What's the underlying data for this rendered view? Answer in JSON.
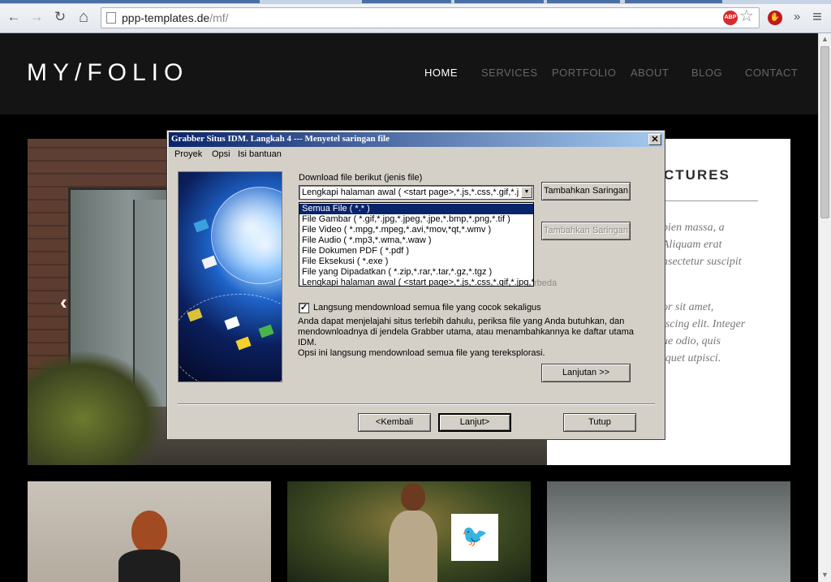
{
  "browser": {
    "url_host": "ppp-templates.de",
    "url_path": "/mf/",
    "nav_icons": [
      "back-arrow-icon",
      "forward-arrow-icon",
      "reload-icon",
      "home-icon"
    ],
    "back_glyph": "←",
    "forward_glyph": "→",
    "reload_glyph": "↻",
    "home_glyph": "⌂",
    "adblock_label": "ABP",
    "star_glyph": "☆",
    "more_glyph": "»",
    "menu_glyph": "≡",
    "stop_glyph": "✋",
    "adblock_color": "#d92b2b"
  },
  "site": {
    "logo": "MY/FOLIO",
    "nav": [
      "HOME",
      "SERVICES",
      "PORTFOLIO",
      "ABOUT",
      "BLOG",
      "CONTACT"
    ],
    "active_nav": "HOME",
    "slider_prev_glyph": "‹",
    "panel_heading": "CTURES",
    "panel_paragraph_1": [
      "pien massa, a",
      "Aliquam erat",
      "nsectetur suscipit"
    ],
    "panel_paragraph_2": [
      "or sit amet,",
      "iscing elit. Integer",
      "ue odio, quis",
      "iquet utpisci."
    ],
    "twitter_glyph": "🐦"
  },
  "dialog": {
    "title": "Grabber Situs IDM. Langkah 4 --- Menyetel saringan file",
    "close_glyph": "✕",
    "menu": [
      "Proyek",
      "Opsi",
      "Isi bantuan"
    ],
    "download_label": "Download file berikut (jenis file)",
    "combo_value": "Lengkapi halaman awal  ( <start page>,*.js,*.css,*.gif,*.jpg,*.jp",
    "combo_arrow": "▼",
    "dropdown_options": [
      "Semua File  ( *.* )",
      "File Gambar  ( *.gif,*.jpg,*.jpeg,*.jpe,*.bmp,*.png,*.tif )",
      "File Video  ( *.mpg,*.mpeg,*.avi,*mov,*qt,*.wmv )",
      "File Audio  ( *.mp3,*.wma,*.waw )",
      "File Dokumen PDF  ( *.pdf )",
      "File Eksekusi  ( *.exe )",
      "File yang Dipadatkan  ( *.zip,*.rar,*.tar,*.gz,*.tgz )",
      "Lengkapi halaman awal  ( <start page>,*.js,*.css,*.gif,*.jpg,*.jp"
    ],
    "selected_option_index": 0,
    "hidden_suffix": "rbeda",
    "add_filter_btn": "Tambahkan Saringan",
    "add_filter_btn_2": "Tambahkan Saringan",
    "checkbox_checked": true,
    "checkbox_glyph": "✓",
    "checkbox_label": "Langsung mendownload semua file yang cocok sekaligus",
    "description_lines": [
      "Anda dapat menjelajahi situs terlebih dahulu, periksa file yang Anda butuhkan, dan",
      "mendownloadnya di jendela Grabber utama, atau  menambahkannya ke daftar utama IDM.",
      "Opsi ini langsung mendownload semua file yang tereksplorasi."
    ],
    "continue_btn": "Lanjutan >>",
    "back_btn": "<Kembali",
    "next_btn": "Lanjut>",
    "close_btn": "Tutup"
  }
}
